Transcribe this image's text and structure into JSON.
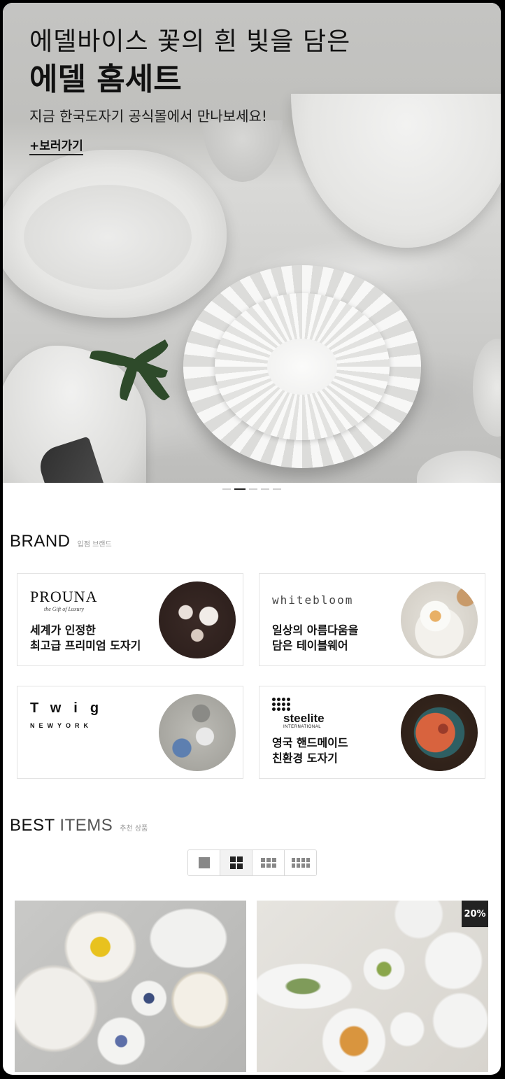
{
  "hero": {
    "line1": "에델바이스 꽃의 흰 빛을 담은",
    "line2": "에델 홈세트",
    "subtitle": "지금 한국도자기 공식몰에서 만나보세요!",
    "link_label": "+보러가기",
    "slides_total": 5,
    "active_slide": 2
  },
  "brand_section": {
    "title": "BRAND",
    "subtitle": "입점 브랜드",
    "brands": [
      {
        "name": "PROUNA",
        "tagline": "the Gift of Luxury",
        "desc_line1": "세계가 인정한",
        "desc_line2": "최고급 프리미엄 도자기"
      },
      {
        "name": "whitebloom",
        "desc_line1": "일상의 아름다움을",
        "desc_line2": "담은 테이블웨어"
      },
      {
        "name": "Twig",
        "sub": "NEWYORK"
      },
      {
        "name": "steelite",
        "sub": "INTERNATIONAL",
        "desc_line1": "영국 핸드메이드",
        "desc_line2": "친환경 도자기"
      }
    ]
  },
  "best_section": {
    "title_bold": "BEST",
    "title_light": "ITEMS",
    "subtitle": "추천 상품",
    "view_modes": [
      "1-column",
      "2-column",
      "3-column",
      "4-column"
    ],
    "active_view": "2-column",
    "products": [
      {
        "badge": ""
      },
      {
        "badge": "20%"
      }
    ]
  },
  "colors": {
    "text": "#111111",
    "badge_bg": "#222222",
    "card_border": "#e3e3e3",
    "hero_bg": "#c4c4c2"
  }
}
